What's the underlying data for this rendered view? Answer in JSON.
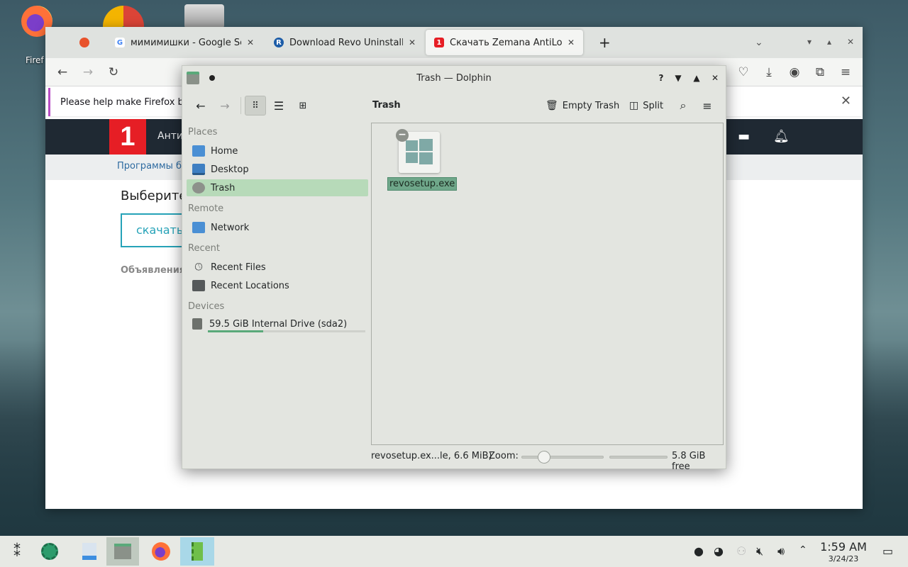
{
  "desktop": {
    "icons": [
      {
        "label": "Firef"
      }
    ]
  },
  "firefox": {
    "tabs": [
      {
        "label": "",
        "favicon": "firefox-icon"
      },
      {
        "label": "мимимишки - Google Sea",
        "favicon": "google-icon"
      },
      {
        "label": "Download Revo Uninstalle",
        "favicon": "revo-icon"
      },
      {
        "label": "Скачать Zemana AntiLogg",
        "favicon": "softportal-icon"
      }
    ],
    "new_tab": "+",
    "notice": "Please help make Firefox be",
    "site": {
      "logo": "1",
      "nav_text": "Антив",
      "breadcrumb": "Программы бе",
      "heading": "Выберите",
      "download_label": "скачать",
      "ads_label": "Объявления"
    }
  },
  "dolphin": {
    "title": "Trash — Dolphin",
    "title_help": "?",
    "breadcrumb": "Trash",
    "toolbar": {
      "empty_trash": "Empty Trash",
      "split": "Split"
    },
    "places": {
      "sections": [
        {
          "header": "Places",
          "items": [
            {
              "label": "Home",
              "icon": "home-folder-icon"
            },
            {
              "label": "Desktop",
              "icon": "desktop-folder-icon"
            },
            {
              "label": "Trash",
              "icon": "trash-icon",
              "selected": true
            }
          ]
        },
        {
          "header": "Remote",
          "items": [
            {
              "label": "Network",
              "icon": "network-folder-icon"
            }
          ]
        },
        {
          "header": "Recent",
          "items": [
            {
              "label": "Recent Files",
              "icon": "clock-icon"
            },
            {
              "label": "Recent Locations",
              "icon": "recent-locations-icon"
            }
          ]
        },
        {
          "header": "Devices",
          "items": [
            {
              "label": "59.5 GiB Internal Drive (sda2)",
              "icon": "drive-icon",
              "usage_fraction": 0.35
            }
          ]
        }
      ]
    },
    "files": [
      {
        "name": "revosetup.exe",
        "icon": "windows-exe-icon",
        "selected": true
      }
    ],
    "status": {
      "selection": "revosetup.ex...le, 6.6 MiB)",
      "zoom_label": "Zoom:",
      "free_space": "5.8 GiB free"
    },
    "colors": {
      "selection": "#b7dab9",
      "accent": "#5aa97a"
    }
  },
  "taskbar": {
    "clock_time": "1:59 AM",
    "clock_date": "3/24/23"
  }
}
